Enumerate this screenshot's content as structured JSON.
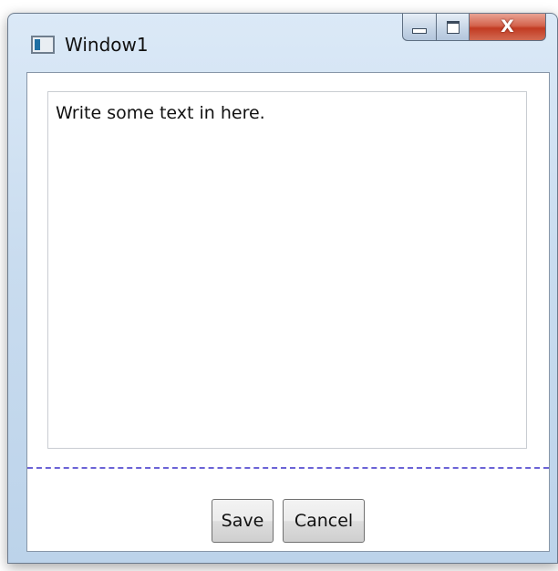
{
  "window": {
    "title": "Window1",
    "icon": "window-app-icon",
    "caption_buttons": {
      "minimize_icon": "minimize-icon",
      "maximize_icon": "maximize-icon",
      "close_label": "X"
    }
  },
  "editor": {
    "value": "Write some text in here."
  },
  "buttons": {
    "save_label": "Save",
    "cancel_label": "Cancel"
  },
  "colors": {
    "splitter": "#6b63d6",
    "close_button": "#c23b22",
    "frame": "#c9dcef"
  }
}
